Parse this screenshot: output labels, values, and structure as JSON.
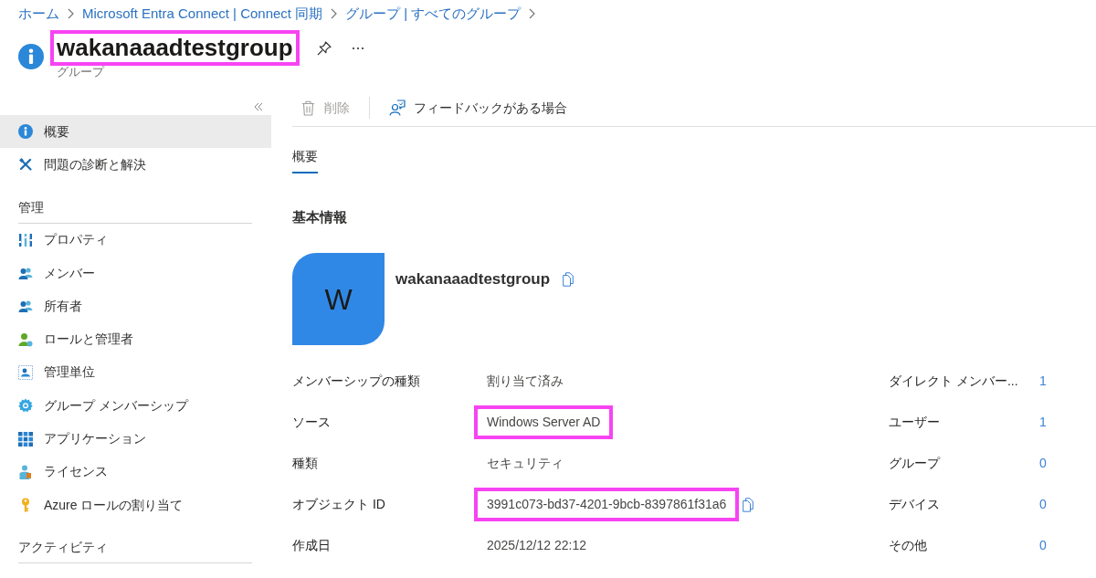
{
  "breadcrumb": [
    "ホーム",
    "Microsoft Entra Connect | Connect 同期",
    "グループ | すべてのグループ"
  ],
  "header": {
    "title": "wakanaaadtestgroup",
    "title_highlighted": true,
    "subtitle": "グループ"
  },
  "sidebar": {
    "sections": [
      {
        "items": [
          {
            "label": "概要",
            "selected": true
          },
          {
            "label": "問題の診断と解決",
            "selected": false
          }
        ]
      },
      {
        "title": "管理",
        "items": [
          {
            "label": "プロパティ",
            "selected": false
          },
          {
            "label": "メンバー",
            "selected": false
          },
          {
            "label": "所有者",
            "selected": false
          },
          {
            "label": "ロールと管理者",
            "selected": false
          },
          {
            "label": "管理単位",
            "selected": false
          },
          {
            "label": "グループ メンバーシップ",
            "selected": false
          },
          {
            "label": "アプリケーション",
            "selected": false
          },
          {
            "label": "ライセンス",
            "selected": false
          },
          {
            "label": "Azure ロールの割り当て",
            "selected": false
          }
        ]
      },
      {
        "title": "アクティビティ"
      }
    ]
  },
  "toolbar": [
    {
      "label": "削除",
      "disabled": true
    },
    {
      "label": "フィードバックがある場合",
      "disabled": false
    }
  ],
  "tabs": [
    {
      "label": "概要",
      "selected": true
    }
  ],
  "basic_info": {
    "heading": "基本情報",
    "avatar_letter": "W",
    "name": "wakanaaadtestgroup",
    "copyable": true
  },
  "properties": [
    {
      "label": "メンバーシップの種類",
      "value": "割り当て済み",
      "highlighted": false,
      "copyable": false
    },
    {
      "label": "ソース",
      "value": "Windows Server AD",
      "highlighted": true,
      "copyable": false
    },
    {
      "label": "種類",
      "value": "セキュリティ",
      "highlighted": false,
      "copyable": false
    },
    {
      "label": "オブジェクト ID",
      "value": "3991c073-bd37-4201-9bcb-8397861f31a6",
      "highlighted": true,
      "copyable": true
    },
    {
      "label": "作成日",
      "value": "2025/12/12 22:12",
      "highlighted": false,
      "copyable": false
    }
  ],
  "member_counts": [
    {
      "label": "ダイレクト メンバー...",
      "value": "1"
    },
    {
      "label": "ユーザー",
      "value": "1"
    },
    {
      "label": "グループ",
      "value": "0"
    },
    {
      "label": "デバイス",
      "value": "0"
    },
    {
      "label": "その他",
      "value": "0"
    }
  ]
}
